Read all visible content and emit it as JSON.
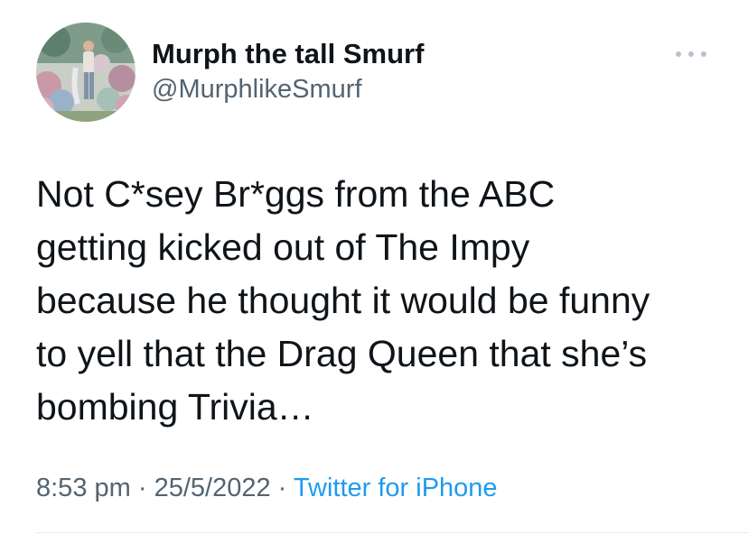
{
  "author": {
    "display_name": "Murph the tall Smurf",
    "handle": "@MurphlikeSmurf"
  },
  "tweet": {
    "text": "Not C*sey Br*ggs from the ABC\ngetting kicked out of The Impy\nbecause he thought it would be funny\nto yell that the Drag Queen that she’s\nbombing Trivia…",
    "time": "8:53 pm",
    "separator": "·",
    "date": "25/5/2022",
    "source": "Twitter for iPhone"
  },
  "icons": {
    "more": "more-options-icon",
    "avatar": "profile-photo"
  },
  "colors": {
    "text_primary": "#0f1419",
    "text_secondary": "#536471",
    "link": "#1d9bf0",
    "more_dots": "#b8c2cc"
  }
}
